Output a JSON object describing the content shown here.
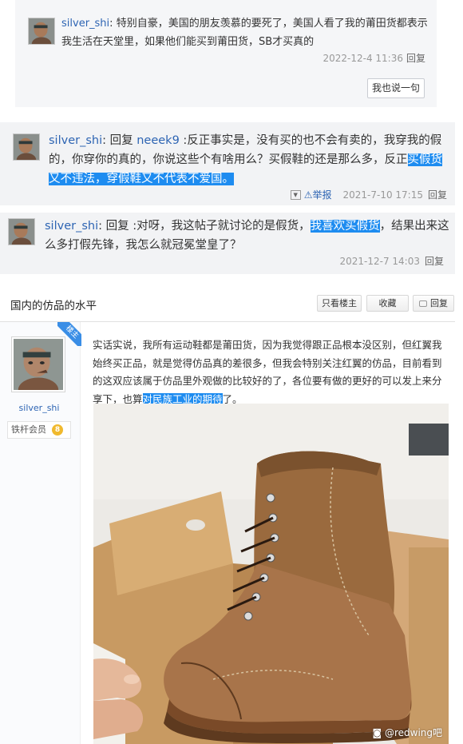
{
  "replies": [
    {
      "username": "silver_shi",
      "text": "特别自豪，美国的朋友羡慕的要死了，美国人看了我的莆田货都表示我生活在天堂里，如果他们能买到莆田货，SB才买真的",
      "time": "2022-12-4 11:36",
      "reply_label": "回复",
      "button_label": "我也说一句"
    },
    {
      "username": "silver_shi",
      "reply_prefix": "回复",
      "reply_to": "neeek9",
      "text_plain": " :反正事实是，没有买的也不会有卖的，我穿我的假的，你穿你的真的，你说这些个有啥用么？买假鞋的还是那么多，反正",
      "text_highlight": "买假货又不违法，穿假鞋又不代表不爱国。",
      "report_label": "举报",
      "time": "2021-7-10 17:15",
      "reply_label": "回复"
    },
    {
      "username": "silver_shi",
      "reply_prefix": "回复",
      "text_plain": " :对呀，我这帖子就讨论的是假货，",
      "text_highlight": "我喜欢买假货",
      "text_after": "，结果出来这么多打假先锋，我怎么就冠冕堂皇了？",
      "time": "2021-12-7 14:03",
      "reply_label": "回复"
    }
  ],
  "thread": {
    "title": "国内的仿品的水平",
    "btn_only_op": "只看楼主",
    "btn_favorite": "收藏",
    "btn_reply": "回复"
  },
  "post": {
    "author": "silver_shi",
    "badge": "楼主",
    "level_name": "铁杆会员",
    "level_num": "8",
    "text_plain": "实话实说，我所有运动鞋都是莆田货，因为我觉得跟正品根本没区别，但红翼我始终买正品，就是觉得仿品真的差很多，但我会特别关注红翼的仿品，目前看到的这双应该属于仿品里外观做的比较好的了，各位要有做的更好的可以发上来分享下，也算",
    "text_highlight": "对民族工业的期待",
    "text_end": "了。",
    "watermark": "@redwing吧"
  },
  "colors": {
    "link": "#2d64b3",
    "highlight": "#1e8cf0",
    "reply_bg": "#f2f3f5",
    "badge": "#3a8ee6",
    "level": "#f0b92e"
  }
}
